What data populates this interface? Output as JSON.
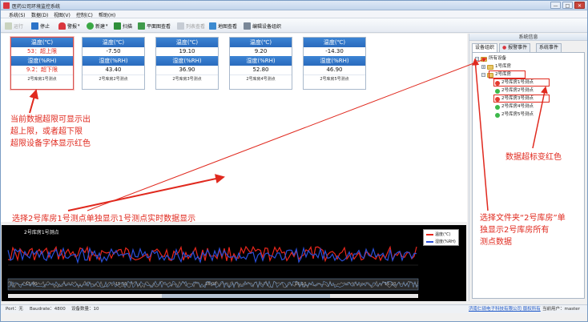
{
  "window": {
    "title": "医药公司环境监控系统",
    "controls": [
      "—",
      "□",
      "✕"
    ]
  },
  "menu": [
    "系统(S)",
    "数据(D)",
    "视图(V)",
    "控制(C)",
    "帮助(H)"
  ],
  "toolbar": {
    "run": "运行",
    "stop": "停止",
    "alarm": "警报",
    "new": "新建",
    "scan": "扫描",
    "plan_view": "平面图查看",
    "list_view": "列表查看",
    "map_view": "地图查看",
    "edit_org": "编辑设备组织"
  },
  "cards": [
    {
      "temp_label": "温度(℃)",
      "temp_value": "53：超上限",
      "temp_alarm": true,
      "hum_label": "湿度(%RH)",
      "hum_value": "9.2：超下限",
      "hum_alarm": true,
      "name": "2号库房1号测点"
    },
    {
      "temp_label": "温度(℃)",
      "temp_value": "-7.50",
      "temp_alarm": false,
      "hum_label": "湿度(%RH)",
      "hum_value": "43.40",
      "hum_alarm": false,
      "name": "2号库房2号测点"
    },
    {
      "temp_label": "温度(℃)",
      "temp_value": "19.10",
      "temp_alarm": false,
      "hum_label": "湿度(%RH)",
      "hum_value": "36.90",
      "hum_alarm": false,
      "name": "2号库房3号测点"
    },
    {
      "temp_label": "温度(℃)",
      "temp_value": "9.20",
      "temp_alarm": false,
      "hum_label": "湿度(%RH)",
      "hum_value": "52.80",
      "hum_alarm": false,
      "name": "2号库房4号测点"
    },
    {
      "temp_label": "温度(℃)",
      "temp_value": "-14.30",
      "temp_alarm": false,
      "hum_label": "湿度(%RH)",
      "hum_value": "46.90",
      "hum_alarm": false,
      "name": "2号库房5号测点"
    }
  ],
  "annotations": {
    "alarm_text": [
      "当前数据超限可显示出",
      "超上限，或者超下限",
      "超限设备字体显示红色"
    ],
    "select_text": "选择2号库房1号测点单独显示1号测点实时数据显示",
    "red_mark_text": "数据超标变红色",
    "folder_text": [
      "选择文件夹“2号库房”单",
      "独显示2号库房所有",
      "测点数据"
    ]
  },
  "panel": {
    "title": "系统信息",
    "tabs": [
      "设备组织",
      "报警事件",
      "系统事件"
    ],
    "tree": {
      "root": "所有设备",
      "folder1": "1号库房",
      "folder2": "2号库房",
      "points": [
        {
          "label": "2号库房1号测点",
          "status": "red"
        },
        {
          "label": "2号库房2号测点",
          "status": "green"
        },
        {
          "label": "2号库房3号测点",
          "status": "red"
        },
        {
          "label": "2号库房4号测点",
          "status": "green"
        },
        {
          "label": "2号库房5号测点",
          "status": "green"
        }
      ]
    }
  },
  "chart_data": {
    "type": "line",
    "title": "2号库房1号测点",
    "series": [
      {
        "name": "温度(℃)",
        "color": "#e8261c"
      },
      {
        "name": "湿度(%RH)",
        "color": "#2a4fd8"
      }
    ],
    "time_ticks": [
      "15:40",
      "15:50",
      "16:00",
      "16:10",
      "16:20"
    ]
  },
  "status": {
    "port": "Port：无",
    "baud": "Baudrate：4800",
    "count": "设备数量：10",
    "company": "济南仁硕电子科技有限公司 版权所有",
    "user": "当前用户：master"
  },
  "colors": {
    "alarm_red": "#e0291e",
    "header_blue": "#2a6bbd",
    "ok_green": "#3db84a"
  }
}
